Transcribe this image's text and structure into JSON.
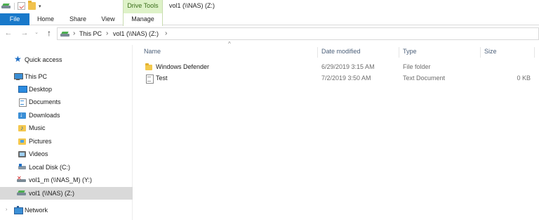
{
  "window": {
    "title": "vol1 (\\\\NAS) (Z:)",
    "context_group": "Drive Tools"
  },
  "quick_access_toolbar": {
    "icons": [
      "network-drive-icon",
      "properties-icon",
      "new-folder-icon",
      "customize-dropdown-icon"
    ]
  },
  "ribbon": {
    "tabs": [
      {
        "label": "File",
        "active": false
      },
      {
        "label": "Home"
      },
      {
        "label": "Share"
      },
      {
        "label": "View"
      },
      {
        "label": "Manage",
        "active": true
      }
    ]
  },
  "address_bar": {
    "icons": {
      "back": "←",
      "forward": "→",
      "recent": "⌄",
      "up": "↑",
      "chevron": "›"
    },
    "crumbs": [
      "This PC",
      "vol1 (\\\\NAS) (Z:)"
    ]
  },
  "nav_pane": {
    "quick_access": "Quick access",
    "this_pc": "This PC",
    "items": [
      {
        "label": "Desktop",
        "icon": "desktop-icon"
      },
      {
        "label": "Documents",
        "icon": "documents-icon"
      },
      {
        "label": "Downloads",
        "icon": "downloads-icon"
      },
      {
        "label": "Music",
        "icon": "music-icon"
      },
      {
        "label": "Pictures",
        "icon": "pictures-icon"
      },
      {
        "label": "Videos",
        "icon": "videos-icon"
      },
      {
        "label": "Local Disk (C:)",
        "icon": "local-disk-icon"
      },
      {
        "label": "vol1_m (\\\\NAS_M) (Y:)",
        "icon": "disconnected-network-drive-icon"
      },
      {
        "label": "vol1 (\\\\NAS) (Z:)",
        "icon": "network-drive-icon",
        "selected": true
      }
    ],
    "network": "Network",
    "expander": "›"
  },
  "file_list": {
    "sort_indicator": "^",
    "columns": {
      "name": "Name",
      "date": "Date modified",
      "type": "Type",
      "size": "Size"
    },
    "rows": [
      {
        "name": "Windows Defender",
        "date": "6/29/2019 3:15 AM",
        "type": "File folder",
        "size": "",
        "icon": "folder-icon"
      },
      {
        "name": "Test",
        "date": "7/2/2019 3:50 AM",
        "type": "Text Document",
        "size": "0 KB",
        "icon": "text-document-icon"
      }
    ]
  },
  "colors": {
    "accent": "#1979ca",
    "context_tab": "#def2c8",
    "selection": "#d9d9d9"
  }
}
